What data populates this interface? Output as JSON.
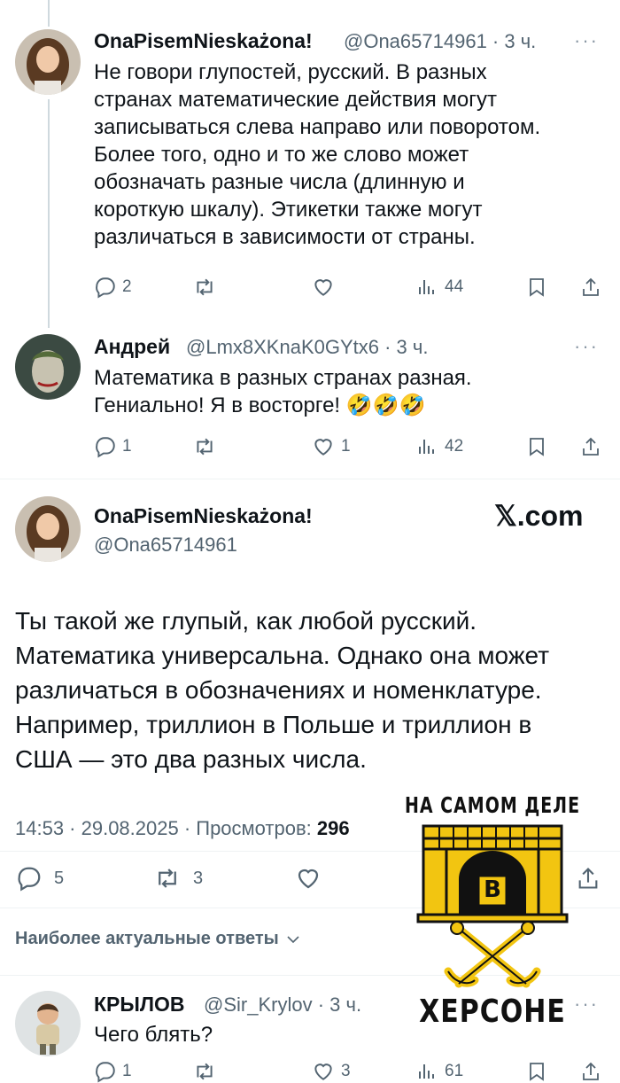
{
  "tweet1": {
    "name": "OnaPisemNieskażona!",
    "meta": "@Ona65714961 · 3 ч.",
    "more": "···",
    "lines": [
      "Не говори глупостей, русский. В разных",
      "странах математические действия могут",
      "записываться слева направо или поворотом.",
      "Более того, одно и то же слово может",
      "обозначать разные числа (длинную и",
      "короткую шкалу). Этикетки также могут",
      "различаться в зависимости от страны."
    ],
    "replies": "2",
    "retweets": "",
    "likes": "",
    "views": "44"
  },
  "tweet2": {
    "name": "Андрей",
    "meta": "@Lmx8XKnaK0GYtx6 · 3 ч.",
    "more": "···",
    "lines": [
      "Математика в разных странах разная.",
      "Гениально! Я в восторге!"
    ],
    "emoji": [
      "🤣",
      "🤣",
      "🤣"
    ],
    "replies": "1",
    "retweets": "",
    "likes": "1",
    "views": "42"
  },
  "main": {
    "name": "OnaPisemNieskażona!",
    "handle": "@Ona65714961",
    "xcom": "𝕏.com",
    "lines": [
      "Ты такой же глупый, как любой русский.",
      "Математика универсальна. Однако она может",
      "различаться в обозначениях и номенклатуре.",
      "Например, триллион в Польше и триллион в",
      "США — это два разных числа."
    ],
    "timestamp": "14:53 · 29.08.2025 · Просмотров: ",
    "views": "296",
    "replies": "5",
    "retweets": "3"
  },
  "sort_label": "Наиболее актуальные ответы",
  "tweet3": {
    "name": "КРЫЛОВ",
    "meta": "@Sir_Krylov · 3 ч.",
    "more": "···",
    "text": "Чего блять?",
    "replies": "1",
    "likes": "3",
    "views": "61"
  },
  "logo": {
    "top": "НА САМОМ ДЕЛЕ",
    "letter": "В",
    "bottom": "ХЕРСОНЕ",
    "colors": {
      "gold": "#f2c511",
      "black": "#111111"
    }
  },
  "colors": {
    "text": "#0f1419",
    "secondary": "#536471",
    "line": "#cfd9de"
  }
}
